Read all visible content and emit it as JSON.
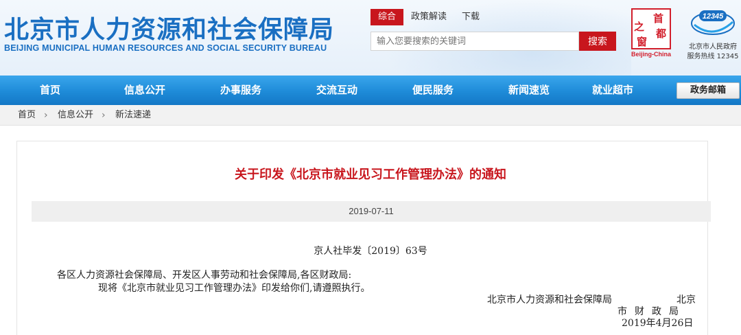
{
  "header": {
    "title_cn": "北京市人力资源和社会保障局",
    "title_en": "BEIJING MUNICIPAL HUMAN RESOURCES AND SOCIAL SECURITY BUREAU",
    "top_tabs": [
      {
        "label": "综合",
        "active": true
      },
      {
        "label": "政策解读",
        "active": false
      },
      {
        "label": "下载",
        "active": false
      }
    ],
    "search": {
      "placeholder": "输入您要搜索的关键词",
      "button_label": "搜索"
    },
    "capital_logo": {
      "chars": [
        "之",
        "首",
        "窗",
        "都"
      ],
      "label": "Beijing-China"
    },
    "hotline": {
      "badge": "12345",
      "line1": "北京市人民政府",
      "line2": "服务热线 12345"
    }
  },
  "nav": {
    "items": [
      "首页",
      "信息公开",
      "办事服务",
      "交流互动",
      "便民服务",
      "新闻速览",
      "就业超市"
    ],
    "mail_button": "政务邮箱"
  },
  "breadcrumb": [
    "首页",
    "信息公开",
    "新法速递"
  ],
  "article": {
    "title": "关于印发《北京市就业见习工作管理办法》的通知",
    "date": "2019-07-11",
    "doc_number": "京人社毕发〔2019〕63号",
    "recipients": "各区人力资源社会保障局、开发区人事劳动和社会保障局,各区财政局:",
    "body": "现将《北京市就业见习工作管理办法》印发给你们,请遵照执行。",
    "signature": {
      "org1": "北京市人力资源和社会保障局",
      "org2_part1": "北京",
      "org2_part2": "市财政局",
      "date": "2019年4月26日"
    }
  },
  "colors": {
    "brand_blue": "#1a6fc2",
    "accent_red": "#c8161d",
    "nav_blue": "#1e8bd8"
  }
}
